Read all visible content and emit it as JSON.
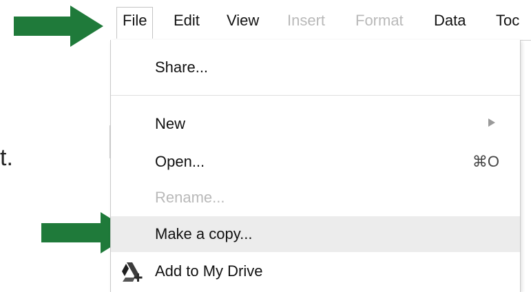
{
  "menubar": {
    "items": [
      {
        "label": "File",
        "state": "active"
      },
      {
        "label": "Edit",
        "state": "normal"
      },
      {
        "label": "View",
        "state": "normal"
      },
      {
        "label": "Insert",
        "state": "disabled"
      },
      {
        "label": "Format",
        "state": "disabled"
      },
      {
        "label": "Data",
        "state": "normal"
      },
      {
        "label": "Toc",
        "state": "normal"
      }
    ]
  },
  "file_menu": {
    "items": [
      {
        "label": "Share..."
      },
      {
        "label": "New",
        "submenu": true
      },
      {
        "label": "Open...",
        "shortcut": "⌘O"
      },
      {
        "label": "Rename...",
        "disabled": true
      },
      {
        "label": "Make a copy...",
        "highlighted": true
      },
      {
        "label": "Add to My Drive",
        "icon": "drive-add-icon"
      }
    ]
  },
  "background": {
    "partial_text": "t."
  },
  "annotations": {
    "arrow_color": "#1f7a3a",
    "arrow_targets": [
      "File",
      "Make a copy..."
    ]
  }
}
